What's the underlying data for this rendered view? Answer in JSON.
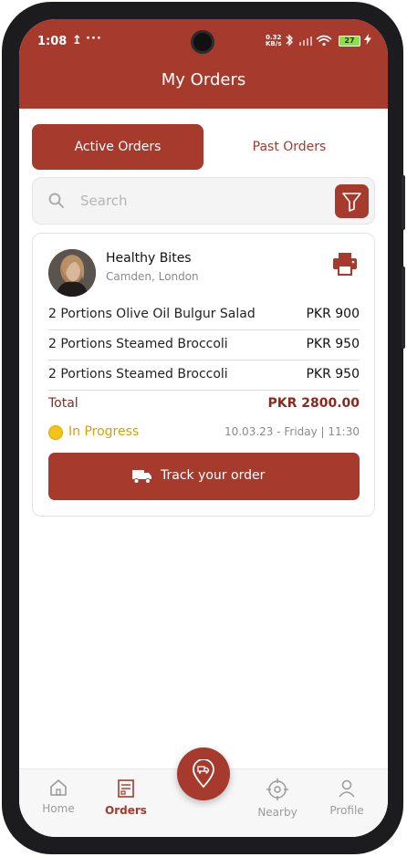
{
  "status_bar": {
    "time": "1:08",
    "upload_glyph": "↥",
    "dots": "···",
    "net_speed": "0.32",
    "net_unit": "KB/s",
    "battery": "27"
  },
  "header": {
    "title": "My Orders"
  },
  "tabs": {
    "active_label": "Active Orders",
    "inactive_label": "Past Orders"
  },
  "search": {
    "placeholder": "Search"
  },
  "order": {
    "restaurant": "Healthy Bites",
    "location": "Camden, London",
    "items": [
      {
        "name": "2 Portions Olive Oil Bulgur Salad",
        "price": "PKR 900"
      },
      {
        "name": "2 Portions Steamed Broccoli",
        "price": "PKR 950"
      },
      {
        "name": "2 Portions Steamed Broccoli",
        "price": "PKR 950"
      }
    ],
    "total_label": "Total",
    "total_amount": "PKR 2800.00",
    "status": "In Progress",
    "date": "10.03.23 - Friday | 11:30",
    "track_label": "Track your order"
  },
  "nav": {
    "items": [
      {
        "label": "Home",
        "icon": "home-icon"
      },
      {
        "label": "Orders",
        "icon": "orders-icon"
      },
      {
        "label": "Nearby",
        "icon": "crosshair-icon"
      },
      {
        "label": "Profile",
        "icon": "user-icon"
      }
    ],
    "center_icon": "location-truck-icon"
  },
  "colors": {
    "brand": "#a63a2c",
    "status_yellow": "#d4a010",
    "total_red": "#8a2a1f"
  }
}
